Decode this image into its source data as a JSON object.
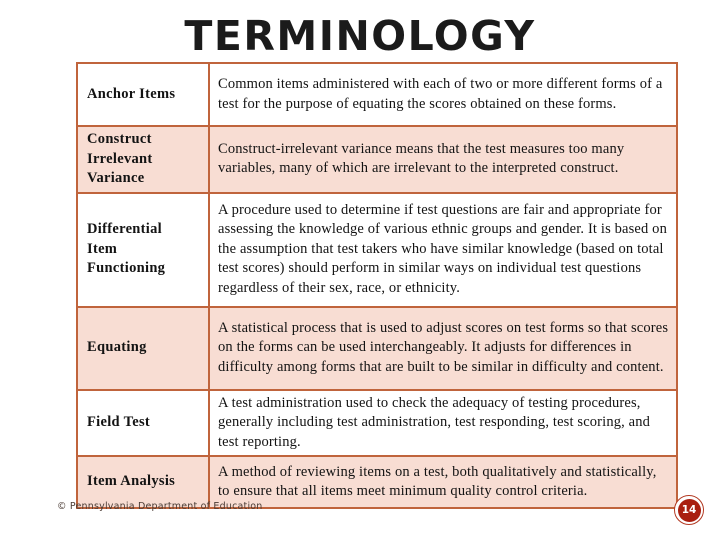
{
  "slide": {
    "title": "TERMINOLOGY",
    "title_color": "#1b1b1b",
    "background_color": "#ffffff"
  },
  "table": {
    "border_color": "#c0643c",
    "row_shade_color": "#f8ddd3",
    "row_plain_color": "#ffffff",
    "rows": [
      {
        "term": "Anchor Items",
        "term_lines": [
          "Anchor Items"
        ],
        "definition": "Common items administered with each of two or more different forms of a test for the purpose of equating the scores obtained on these forms.",
        "shaded": false
      },
      {
        "term": "Construct Irrelevant Variance",
        "term_lines": [
          "Construct",
          "Irrelevant",
          "Variance"
        ],
        "definition": "Construct-irrelevant variance means that the test measures too many variables, many of which are irrelevant to the interpreted construct.",
        "shaded": true
      },
      {
        "term": "Differential Item Functioning",
        "term_lines": [
          "Differential",
          "Item",
          "Functioning"
        ],
        "definition": "A procedure used to determine if test questions are fair and appropriate for assessing the knowledge of various ethnic groups and gender.  It is based on the assumption that test takers who have similar knowledge (based on total test scores) should perform in similar ways on individual test questions regardless of their sex, race, or ethnicity.",
        "shaded": false
      },
      {
        "term": "Equating",
        "term_lines": [
          "Equating"
        ],
        "definition": "A statistical process that is used to adjust scores on test forms so that scores on the forms can be used interchangeably.  It adjusts for differences in difficulty among forms that are built to be similar in difficulty and content.",
        "shaded": true
      },
      {
        "term": "Field Test",
        "term_lines": [
          "Field Test"
        ],
        "definition": "A test administration used to check the adequacy of testing procedures, generally including test administration, test responding, test scoring, and test reporting.",
        "shaded": false
      },
      {
        "term": "Item Analysis",
        "term_lines": [
          "Item Analysis"
        ],
        "definition": "A method of reviewing items on a test, both qualitatively and statistically, to ensure that all items meet minimum quality control criteria.",
        "shaded": true
      }
    ]
  },
  "footer": {
    "credit": "© Pennsylvania Department of Education",
    "page_number": "14",
    "badge_color": "#a91f10",
    "badge_ring_color": "#b33a23"
  }
}
